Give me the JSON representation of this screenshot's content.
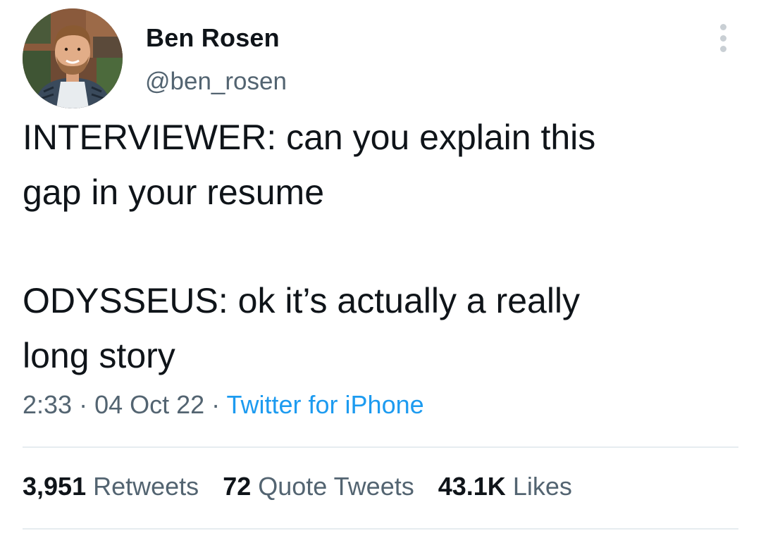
{
  "author": {
    "display_name": "Ben Rosen",
    "handle": "@ben_rosen"
  },
  "tweet": {
    "line1": "INTERVIEWER: can you explain this",
    "line2": "gap in your resume",
    "line3": "ODYSSEUS: ok it’s actually a really",
    "line4": "long story"
  },
  "meta": {
    "time": "2:33",
    "separator": " · ",
    "date": "04 Oct 22",
    "source": "Twitter for iPhone"
  },
  "stats": {
    "retweets_count": "3,951",
    "retweets_label": "Retweets",
    "quotes_count": "72",
    "quotes_label": "Quote Tweets",
    "likes_count": "43.1K",
    "likes_label": "Likes"
  },
  "icons": {
    "more": "more-vertical-icon",
    "avatar": "profile-photo"
  },
  "colors": {
    "text_primary": "#0f1419",
    "text_secondary": "#536471",
    "link": "#1d9bf0",
    "divider": "#e6ecf0"
  }
}
